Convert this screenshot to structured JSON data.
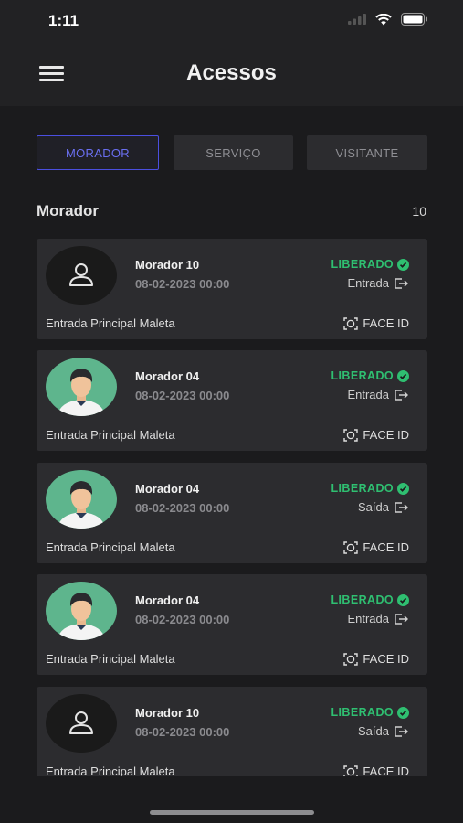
{
  "status_bar": {
    "time": "1:11"
  },
  "header": {
    "title": "Acessos"
  },
  "tabs": [
    {
      "label": "MORADOR",
      "active": true
    },
    {
      "label": "SERVIÇO",
      "active": false
    },
    {
      "label": "VISITANTE",
      "active": false
    }
  ],
  "section": {
    "title": "Morador",
    "count": "10"
  },
  "entries": [
    {
      "name": "Morador 10",
      "datetime": "08-02-2023 00:00",
      "status": "LIBERADO",
      "direction": "Entrada",
      "place": "Entrada Principal Maleta",
      "method": "FACE ID",
      "avatar": "generic-person"
    },
    {
      "name": "Morador 04",
      "datetime": "08-02-2023 00:00",
      "status": "LIBERADO",
      "direction": "Entrada",
      "place": "Entrada Principal Maleta",
      "method": "FACE ID",
      "avatar": "illustrated-man"
    },
    {
      "name": "Morador 04",
      "datetime": "08-02-2023 00:00",
      "status": "LIBERADO",
      "direction": "Saída",
      "place": "Entrada Principal Maleta",
      "method": "FACE ID",
      "avatar": "illustrated-man"
    },
    {
      "name": "Morador 04",
      "datetime": "08-02-2023 00:00",
      "status": "LIBERADO",
      "direction": "Entrada",
      "place": "Entrada Principal Maleta",
      "method": "FACE ID",
      "avatar": "illustrated-man"
    },
    {
      "name": "Morador 10",
      "datetime": "08-02-2023 00:00",
      "status": "LIBERADO",
      "direction": "Saída",
      "place": "Entrada Principal Maleta",
      "method": "FACE ID",
      "avatar": "generic-person"
    }
  ],
  "colors": {
    "accent": "#4b4fe0",
    "status_ok": "#2fbf71",
    "card": "#2c2c2f",
    "background": "#1b1b1d"
  }
}
